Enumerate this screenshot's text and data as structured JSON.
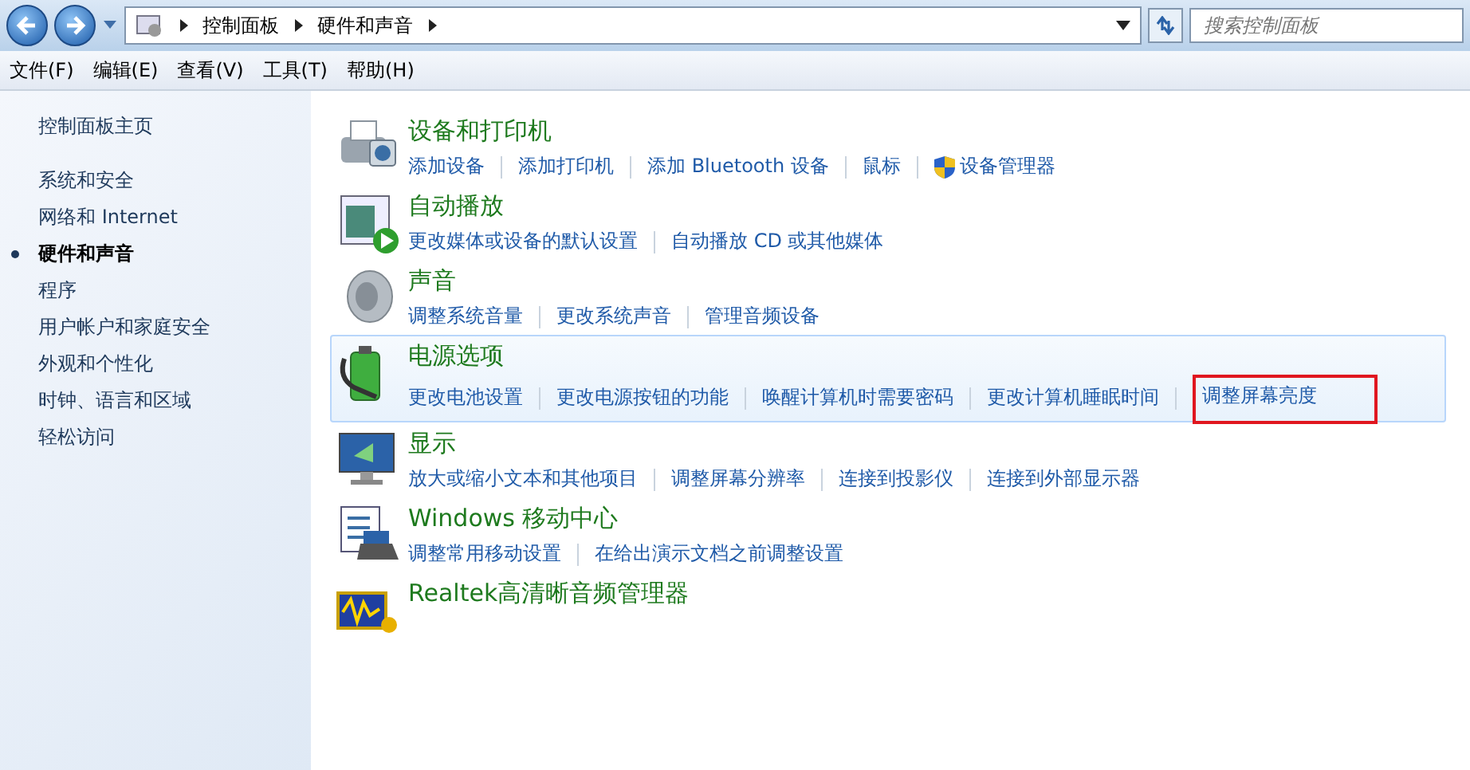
{
  "address_bar": {
    "breadcrumbs": [
      "控制面板",
      "硬件和声音"
    ]
  },
  "search": {
    "placeholder": "搜索控制面板"
  },
  "menu": [
    "文件(F)",
    "编辑(E)",
    "查看(V)",
    "工具(T)",
    "帮助(H)"
  ],
  "sidebar": {
    "home": "控制面板主页",
    "items": [
      {
        "label": "系统和安全",
        "selected": false
      },
      {
        "label": "网络和 Internet",
        "selected": false
      },
      {
        "label": "硬件和声音",
        "selected": true
      },
      {
        "label": "程序",
        "selected": false
      },
      {
        "label": "用户帐户和家庭安全",
        "selected": false
      },
      {
        "label": "外观和个性化",
        "selected": false
      },
      {
        "label": "时钟、语言和区域",
        "selected": false
      },
      {
        "label": "轻松访问",
        "selected": false
      }
    ]
  },
  "categories": [
    {
      "kind": "printer",
      "title": "设备和打印机",
      "hovered": false,
      "links": [
        {
          "label": "添加设备",
          "highlighted": false,
          "shield": false
        },
        {
          "label": "添加打印机",
          "highlighted": false,
          "shield": false
        },
        {
          "label": "添加 Bluetooth 设备",
          "highlighted": false,
          "shield": false
        },
        {
          "label": "鼠标",
          "highlighted": false,
          "shield": false
        },
        {
          "label": "设备管理器",
          "highlighted": false,
          "shield": true
        }
      ]
    },
    {
      "kind": "autoplay",
      "title": "自动播放",
      "hovered": false,
      "links": [
        {
          "label": "更改媒体或设备的默认设置",
          "highlighted": false,
          "shield": false
        },
        {
          "label": "自动播放 CD 或其他媒体",
          "highlighted": false,
          "shield": false
        }
      ]
    },
    {
      "kind": "sound",
      "title": "声音",
      "hovered": false,
      "links": [
        {
          "label": "调整系统音量",
          "highlighted": false,
          "shield": false
        },
        {
          "label": "更改系统声音",
          "highlighted": false,
          "shield": false
        },
        {
          "label": "管理音频设备",
          "highlighted": false,
          "shield": false
        }
      ]
    },
    {
      "kind": "power",
      "title": "电源选项",
      "hovered": true,
      "links": [
        {
          "label": "更改电池设置",
          "highlighted": false,
          "shield": false
        },
        {
          "label": "更改电源按钮的功能",
          "highlighted": false,
          "shield": false
        },
        {
          "label": "唤醒计算机时需要密码",
          "highlighted": false,
          "shield": false
        },
        {
          "label": "更改计算机睡眠时间",
          "highlighted": false,
          "shield": false
        },
        {
          "label": "调整屏幕亮度",
          "highlighted": true,
          "shield": false
        }
      ]
    },
    {
      "kind": "display",
      "title": "显示",
      "hovered": false,
      "links": [
        {
          "label": "放大或缩小文本和其他项目",
          "highlighted": false,
          "shield": false
        },
        {
          "label": "调整屏幕分辨率",
          "highlighted": false,
          "shield": false
        },
        {
          "label": "连接到投影仪",
          "highlighted": false,
          "shield": false
        },
        {
          "label": "连接到外部显示器",
          "highlighted": false,
          "shield": false
        }
      ]
    },
    {
      "kind": "mobility",
      "title": "Windows 移动中心",
      "hovered": false,
      "links": [
        {
          "label": "调整常用移动设置",
          "highlighted": false,
          "shield": false
        },
        {
          "label": "在给出演示文档之前调整设置",
          "highlighted": false,
          "shield": false
        }
      ]
    },
    {
      "kind": "audio",
      "title": "Realtek高清晰音频管理器",
      "hovered": false
    }
  ]
}
